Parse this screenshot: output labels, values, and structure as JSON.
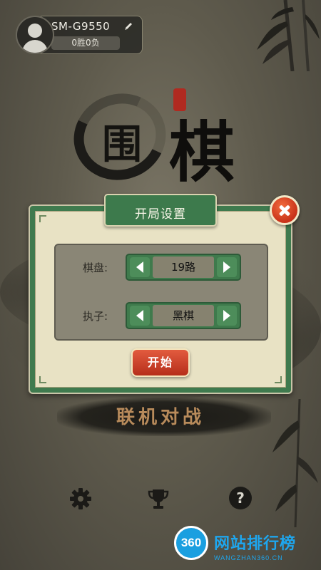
{
  "profile": {
    "name": "SM-G9550",
    "record": "0胜0负"
  },
  "logo": {
    "char1": "围",
    "char2": "棋"
  },
  "dialog": {
    "title": "开局设置",
    "board_label": "棋盘:",
    "board_value": "19路",
    "side_label": "执子:",
    "side_value": "黑棋",
    "start_label": "开始"
  },
  "menu": {
    "online_battle": "联机对战"
  },
  "bottom_bar": {
    "icons": [
      "gear-icon",
      "trophy-icon",
      "help-icon"
    ],
    "help_glyph": "?"
  },
  "watermark": {
    "badge": "360",
    "title": "网站排行榜",
    "url": "WANGZHAN360.CN"
  },
  "colors": {
    "dialog_green": "#3f7a4e",
    "paper": "#e8e2c4",
    "close_red": "#c8321a",
    "brush_text": "#b88b5b",
    "watermark_blue": "#1ea6ee"
  }
}
